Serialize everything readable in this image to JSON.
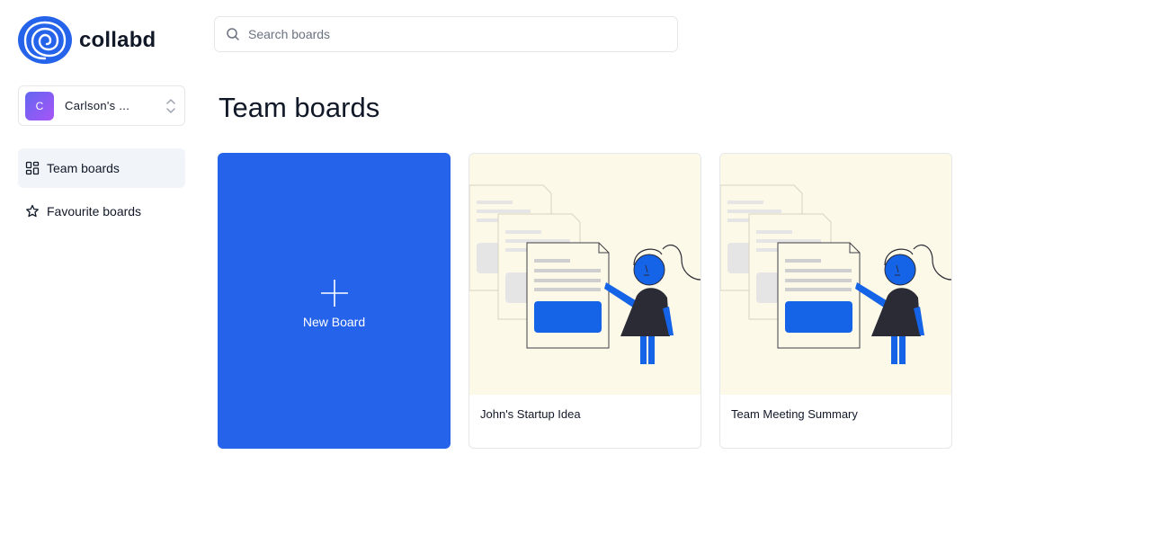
{
  "app": {
    "name": "collabd",
    "logo_icon": "spiral-logo-icon",
    "brand_color": "#2563eb"
  },
  "search": {
    "placeholder": "Search boards",
    "value": "",
    "icon": "search-icon"
  },
  "org": {
    "initial": "C",
    "name": "Carlson's ...",
    "icon": "chevron-up-down-icon"
  },
  "sidebar": {
    "items": [
      {
        "label": "Team boards",
        "icon": "dashboard-grid-icon",
        "active": true
      },
      {
        "label": "Favourite boards",
        "icon": "star-icon",
        "active": false
      }
    ]
  },
  "main": {
    "title": "Team boards",
    "new_board": {
      "label": "New Board",
      "icon": "plus-icon"
    },
    "boards": [
      {
        "title": "John's Startup Idea",
        "thumbnail": "presentation-illustration"
      },
      {
        "title": "Team Meeting Summary",
        "thumbnail": "presentation-illustration"
      }
    ]
  }
}
